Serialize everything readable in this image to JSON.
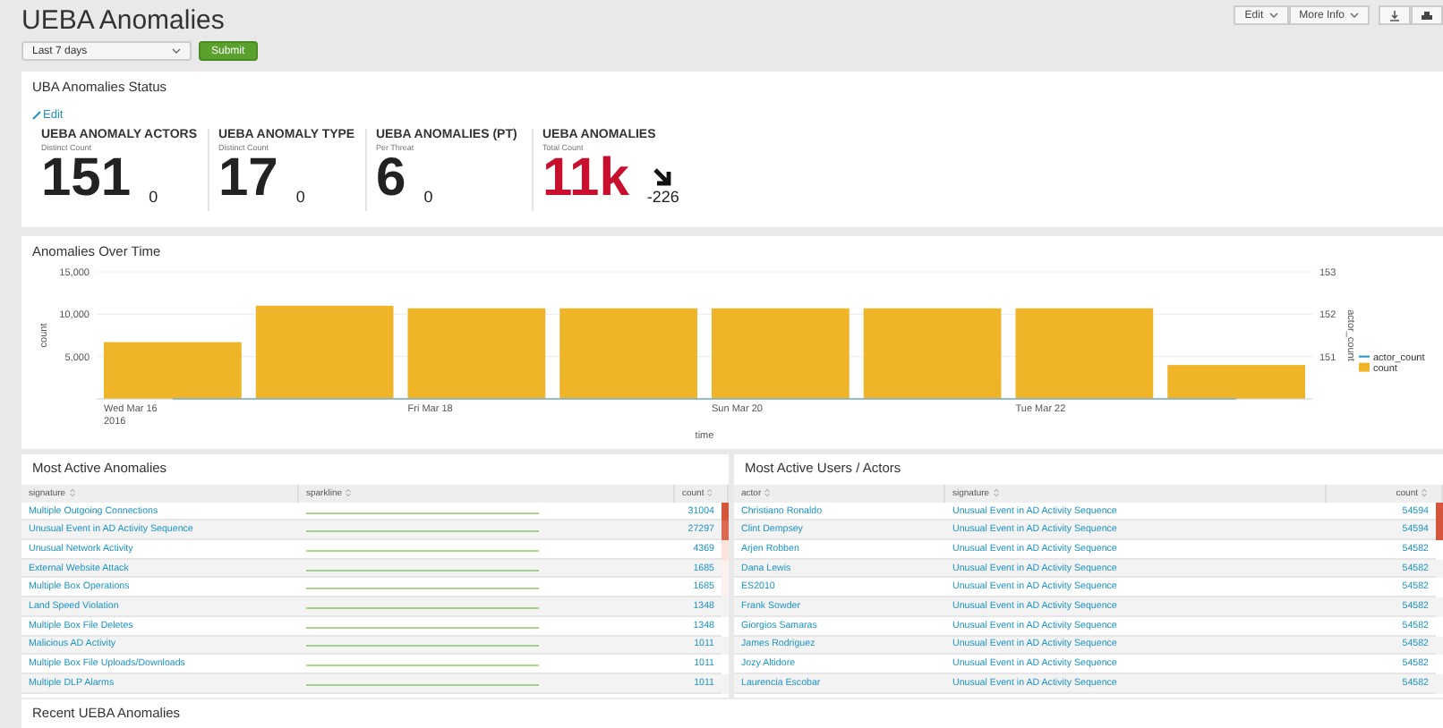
{
  "header": {
    "title": "UEBA Anomalies",
    "time_range": "Last 7 days",
    "submit": "Submit",
    "buttons": [
      "Edit",
      "More Info"
    ]
  },
  "status": {
    "title": "UBA Anomalies Status",
    "edit": "Edit",
    "metrics": [
      {
        "label": "UEBA ANOMALY ACTORS",
        "sublabel": "Distinct Count",
        "value": "151",
        "delta": "0",
        "trend_down": false,
        "color": "#222222"
      },
      {
        "label": "UEBA ANOMALY TYPE",
        "sublabel": "Distinct Count",
        "value": "17",
        "delta": "0",
        "trend_down": false,
        "color": "#222222"
      },
      {
        "label": "UEBA ANOMALIES (PT)",
        "sublabel": "Per Threat",
        "value": "6",
        "delta": "0",
        "trend_down": false,
        "color": "#222222"
      },
      {
        "label": "UEBA ANOMALIES",
        "sublabel": "Total Count",
        "value": "11k",
        "delta": "-226",
        "trend_down": true,
        "color": "#c8102e"
      }
    ]
  },
  "timeline": {
    "title": "Anomalies Over Time",
    "right_axis": {
      "title": "actor_count",
      "ticks": [
        "153",
        "152",
        "151"
      ]
    },
    "chart_data": {
      "type": "bar",
      "xlabel": "time",
      "ylabel": "count",
      "categories": [
        "Wed Mar 16\n2016",
        null,
        "Fri Mar 18",
        null,
        "Sun Mar 20",
        null,
        "Tue Mar 22",
        null
      ],
      "ylim": [
        0,
        15000
      ],
      "yticks": [
        {
          "value": 5000,
          "label": "5,000"
        },
        {
          "value": 10000,
          "label": "10,000"
        },
        {
          "value": 15000,
          "label": "15,000"
        }
      ],
      "series": [
        {
          "name": "actor_count",
          "color": "#1e93c6",
          "values": [
            150,
            150,
            150,
            150,
            150,
            150,
            150,
            150
          ]
        },
        {
          "name": "count",
          "color": "#f0b429",
          "values": [
            6700,
            11000,
            10700,
            10700,
            10700,
            10700,
            10700,
            4000
          ]
        }
      ]
    }
  },
  "anomalies": {
    "title": "Most Active Anomalies",
    "columns": [
      "signature",
      "sparkline",
      "count"
    ],
    "rows": [
      {
        "signature": "Multiple Outgoing Connections",
        "count": "31004",
        "color": "#d6563c"
      },
      {
        "signature": "Unusual Event in AD Activity Sequence",
        "count": "27297",
        "color": "#db6a52"
      },
      {
        "signature": "Unusual Network Activity",
        "count": "4369",
        "color": "#fbe2db"
      },
      {
        "signature": "External Website Attack",
        "count": "1685",
        "color": "#fdf1ed"
      },
      {
        "signature": "Multiple Box Operations",
        "count": "1685",
        "color": "#fdf1ed"
      },
      {
        "signature": "Land Speed Violation",
        "count": "1348"
      },
      {
        "signature": "Multiple Box File Deletes",
        "count": "1348"
      },
      {
        "signature": "Malicious AD Activity",
        "count": "1011"
      },
      {
        "signature": "Multiple Box File Uploads/Downloads",
        "count": "1011"
      },
      {
        "signature": "Multiple DLP Alarms",
        "count": "1011"
      }
    ]
  },
  "actors": {
    "title": "Most Active Users / Actors",
    "columns": [
      "actor",
      "signature",
      "count"
    ],
    "rows": [
      {
        "actor": "Christiano Ronaldo",
        "signature": "Unusual Event in AD Activity Sequence",
        "count": "54594",
        "color": "#d6563c"
      },
      {
        "actor": "Clint Dempsey",
        "signature": "Unusual Event in AD Activity Sequence",
        "count": "54594",
        "color": "#d6563c"
      },
      {
        "actor": "Arjen Robben",
        "signature": "Unusual Event in AD Activity Sequence",
        "count": "54582"
      },
      {
        "actor": "Dana Lewis",
        "signature": "Unusual Event in AD Activity Sequence",
        "count": "54582"
      },
      {
        "actor": "ES2010",
        "signature": "Unusual Event in AD Activity Sequence",
        "count": "54582"
      },
      {
        "actor": "Frank Sowder",
        "signature": "Unusual Event in AD Activity Sequence",
        "count": "54582"
      },
      {
        "actor": "Giorgios Samaras",
        "signature": "Unusual Event in AD Activity Sequence",
        "count": "54582"
      },
      {
        "actor": "James Rodriguez",
        "signature": "Unusual Event in AD Activity Sequence",
        "count": "54582"
      },
      {
        "actor": "Jozy Altidore",
        "signature": "Unusual Event in AD Activity Sequence",
        "count": "54582"
      },
      {
        "actor": "Laurencia Escobar",
        "signature": "Unusual Event in AD Activity Sequence",
        "count": "54582"
      }
    ]
  },
  "recent": {
    "title": "Recent UEBA Anomalies"
  }
}
